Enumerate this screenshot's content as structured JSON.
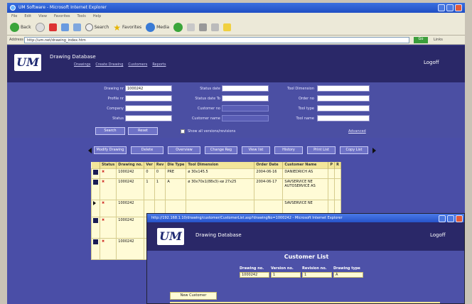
{
  "browser": {
    "title": "UM Software - Microsoft Internet Explorer",
    "menu": [
      "File",
      "Edit",
      "View",
      "Favorites",
      "Tools",
      "Help"
    ],
    "toolbar": {
      "back": "Back",
      "search": "Search",
      "favorites": "Favorites",
      "media": "Media"
    },
    "address_label": "Address",
    "address": "http://um.net/drawing_index.htm",
    "go": "Go",
    "links": "Links"
  },
  "app": {
    "logo": "UM",
    "title": "Drawing Database",
    "nav": [
      "Drawings",
      "Create Drawing",
      "Customers",
      "Reports"
    ],
    "logoff": "Logoff"
  },
  "form": {
    "drawing_no_label": "Drawing nr",
    "drawing_no_value": "1000242",
    "profile_no_label": "Profile nr",
    "company_label": "Company",
    "status_label": "Status",
    "status_date_label": "Status date",
    "status_date_to_label": "Status date To",
    "customer_no_label": "Customer no",
    "customer_name_label": "Customer name",
    "tool_dimension_label": "Tool Dimension",
    "order_no_label": "Order no",
    "tool_type_label": "Tool type",
    "tool_name_label": "Tool name",
    "search_button": "Search",
    "reset_button": "Reset",
    "show_all_label": "Show all versions/revisions",
    "advanced_link": "Advanced"
  },
  "actions": [
    "Modify Drawing",
    "Delete",
    "Overview",
    "Change Reg",
    "View list",
    "History",
    "Print List",
    "Copy List"
  ],
  "table": {
    "headers": [
      "Status",
      "Drawing no.",
      "Ver",
      "Rev",
      "Die Type",
      "Tool Dimension",
      "Order Date",
      "Customer Name",
      "P",
      "R"
    ],
    "rows": [
      {
        "drawing": "1000242",
        "ver": "0",
        "rev": "0",
        "type": "PRE",
        "dimension": "ø 30x145.5",
        "date": "2004-06-16",
        "customer": "DANIEDRICH AS"
      },
      {
        "drawing": "1000242",
        "ver": "1",
        "rev": "1",
        "type": "A",
        "dimension": "ø 30x70x1(88x3)-xø 27x25",
        "date": "2004-06-17",
        "customer": "SAVSERVICE NE AUTOSERVICE AS"
      },
      {
        "drawing": "1000242",
        "ver": "",
        "rev": "",
        "type": "",
        "dimension": "",
        "date": "",
        "customer": "SAVSERVICE NE"
      },
      {
        "drawing": "1000242",
        "ver": "",
        "rev": "",
        "type": "",
        "dimension": "",
        "date": "",
        "customer": ""
      },
      {
        "drawing": "1000242",
        "ver": "",
        "rev": "",
        "type": "",
        "dimension": "",
        "date": "",
        "customer": ""
      }
    ]
  },
  "popup": {
    "window_title": "http://192.168.1.10/drawing/customer/CustomerList.asp?drawingNo=1000242 - Microsoft Internet Explorer",
    "logo": "UM",
    "app_title": "Drawing Database",
    "logoff": "Logoff",
    "heading": "Customer List",
    "columns": [
      "Drawing no.",
      "Version no.",
      "Revision no.",
      "Drawing type"
    ],
    "values": [
      "1000242",
      "1",
      "1",
      "A"
    ],
    "new_customer_button": "New Customer"
  }
}
